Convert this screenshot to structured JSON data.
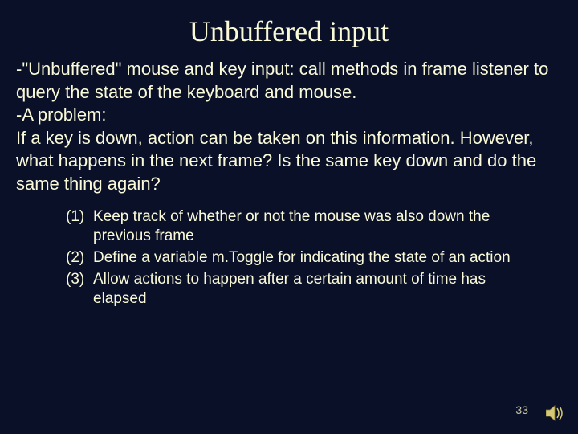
{
  "title": "Unbuffered input",
  "body": {
    "p1": "-\"Unbuffered\" mouse and key input: call methods in frame listener to query the state of the keyboard and mouse.",
    "p2": "-A problem:",
    "p3": "If a key is down, action can be taken on this information. However, what happens in the next frame? Is the same key down and do the same thing again?"
  },
  "list": [
    {
      "marker": "(1)",
      "text": "Keep track of whether or not the mouse was also down the previous frame"
    },
    {
      "marker": "(2)",
      "text": "Define a variable m.Toggle for indicating the state of an action"
    },
    {
      "marker": "(3)",
      "text": "Allow actions to happen after a certain amount of time has elapsed"
    }
  ],
  "page_number": "33"
}
